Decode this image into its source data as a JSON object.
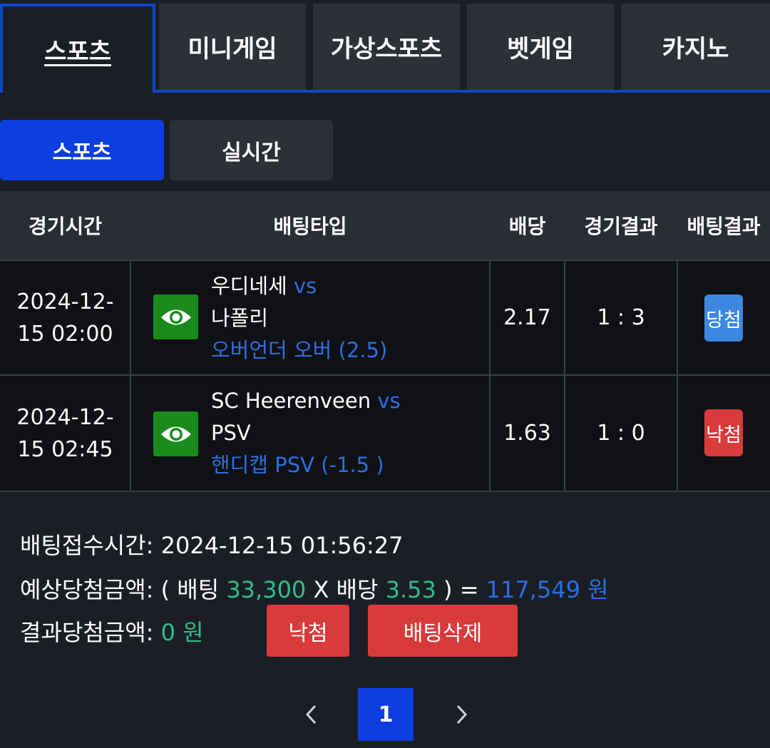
{
  "top_tabs": [
    "스포츠",
    "미니게임",
    "가상스포츠",
    "벳게임",
    "카지노"
  ],
  "sub_tabs": {
    "active": "스포츠",
    "inactive": "실시간"
  },
  "table": {
    "headers": [
      "경기시간",
      "배팅타입",
      "배당",
      "경기결과",
      "배팅결과"
    ],
    "rows": [
      {
        "time_line1": "2024-12-",
        "time_line2": "15 02:00",
        "home": "우디네세",
        "vs": "vs",
        "away": "나폴리",
        "bet": "오버언더 오버 (2.5)",
        "odds": "2.17",
        "score": "1 : 3",
        "result": "당첨",
        "result_color": "#3d87e0"
      },
      {
        "time_line1": "2024-12-",
        "time_line2": "15 02:45",
        "home": "SC Heerenveen",
        "vs": "vs",
        "away": "PSV",
        "bet": "핸디캡 PSV (-1.5 )",
        "odds": "1.63",
        "score": "1 : 0",
        "result": "낙첨",
        "result_color": "#d93b3b"
      }
    ]
  },
  "summary": {
    "accept_label": "배팅접수시간:",
    "accept_time": "2024-12-15 01:56:27",
    "expected_label": "예상당첨금액:",
    "expected_open": "( 배팅",
    "stake": "33,300",
    "x_sep": "X 배당",
    "total_odds": "3.53",
    "expected_close": ") =",
    "expected_amount": "117,549 원",
    "result_label": "결과당첨금액:",
    "result_amount": "0 원",
    "status_button": "낙첨",
    "delete_button": "배팅삭제"
  },
  "pagination": {
    "current": "1"
  },
  "colors": {
    "accent_blue": "#0c3ee0",
    "win_blue": "#3d87e0",
    "lose_red": "#d93b3b",
    "green": "#2fbf88"
  }
}
